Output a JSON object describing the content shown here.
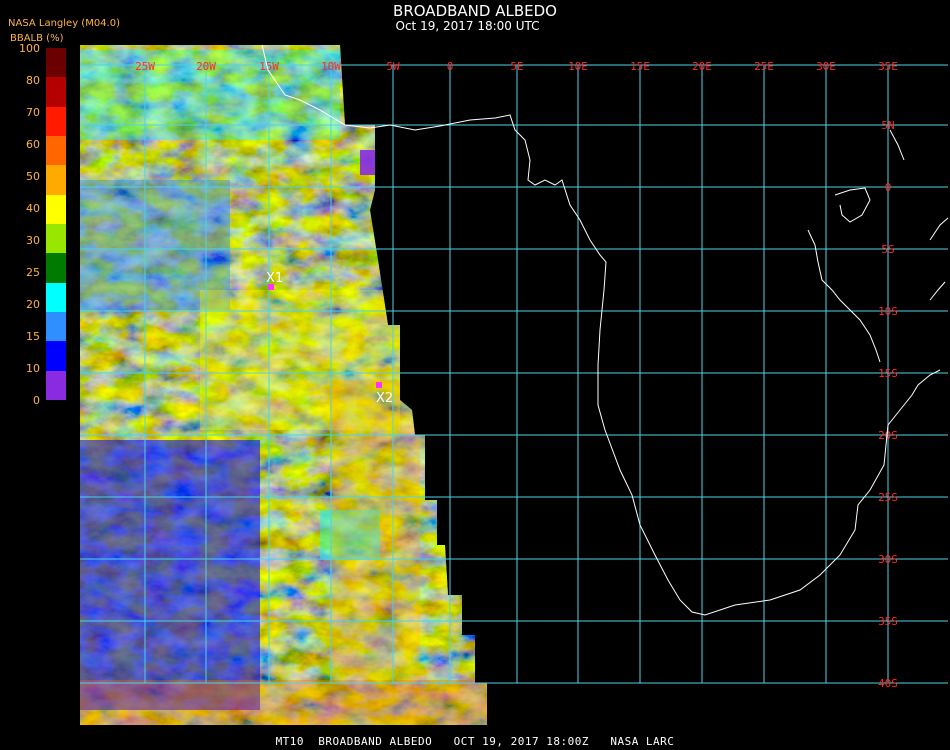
{
  "header": {
    "title": "BROADBAND ALBEDO",
    "subtitle": "Oct 19, 2017 18:00 UTC",
    "source": "NASA Langley (M04.0)",
    "colorbar_label": "BBALB (%)"
  },
  "colorbar": {
    "ticks": [
      "100",
      "80",
      "70",
      "60",
      "50",
      "40",
      "30",
      "25",
      "20",
      "15",
      "10",
      "0"
    ],
    "colors": [
      "#6b0000",
      "#b50000",
      "#ff1a00",
      "#ff6600",
      "#ffaa00",
      "#ffff00",
      "#99e600",
      "#007a00",
      "#00ffff",
      "#2f8fff",
      "#0000ff",
      "#8a2be2"
    ]
  },
  "map": {
    "lon_labels": [
      "25W",
      "20W",
      "15W",
      "10W",
      "5W",
      "0",
      "5E",
      "10E",
      "15E",
      "20E",
      "25E",
      "30E",
      "35E"
    ],
    "lat_labels": [
      "5N",
      "0",
      "5S",
      "10S",
      "15S",
      "20S",
      "25S",
      "30S",
      "35S",
      "40S"
    ],
    "grid_color": "#4fd2e6",
    "label_color": "#ff2a2a",
    "coast_color": "#ffffff",
    "markers": [
      {
        "label": "X1",
        "color": "#ff33ff"
      },
      {
        "label": "X2",
        "color": "#ff33ff"
      }
    ]
  },
  "footer": {
    "text": "MT10  BROADBAND ALBEDO   OCT 19, 2017 18:00Z   NASA LARC"
  }
}
